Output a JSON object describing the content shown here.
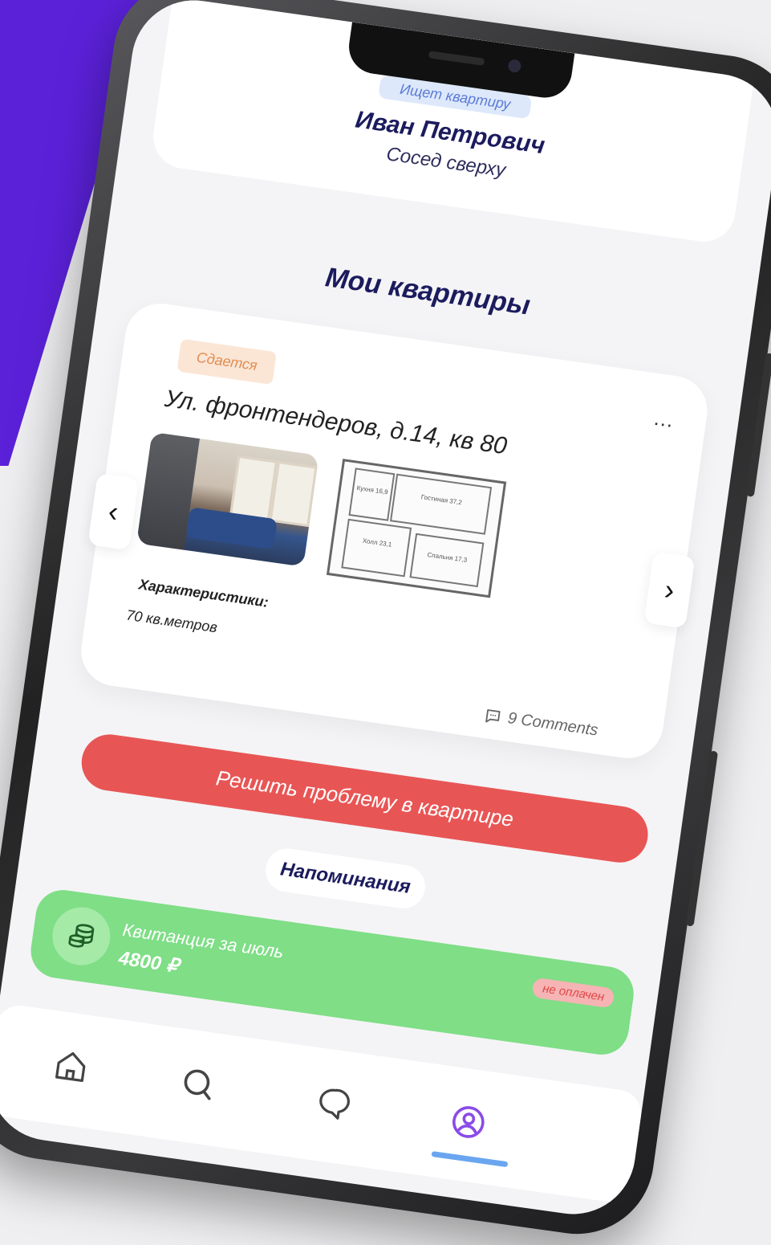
{
  "profile": {
    "status_badge": "Ищет квартиру",
    "name": "Иван Петрович",
    "role": "Сосед сверху"
  },
  "apartments": {
    "section_title": "Мои квартиры",
    "card": {
      "status": "Сдается",
      "more_glyph": "...",
      "address": "Ул. фронтендеров, д.14, кв 80",
      "characteristics_label": "Характеристики:",
      "area": "70 кв.метров",
      "comments": "9 Comments",
      "prev_glyph": "‹",
      "next_glyph": "›",
      "plan_rooms": [
        "Кухня 16,9",
        "Гостиная 37,2",
        "Холл 23,1",
        "Спальня 17,3"
      ]
    }
  },
  "actions": {
    "fix_problem": "Решить проблему в квартире"
  },
  "reminders": {
    "title": "Напоминания",
    "invoice": {
      "title": "Квитанция за июль",
      "amount": "4800 ₽",
      "status": "не оплачен"
    }
  },
  "tabbar": {
    "items": [
      "home-icon",
      "search-icon",
      "chat-icon",
      "profile-icon"
    ],
    "active": "profile-icon"
  },
  "colors": {
    "accent_purple": "#5b21d9",
    "danger": "#e85555",
    "success": "#7fde86",
    "active_tab": "#8a4be8"
  }
}
